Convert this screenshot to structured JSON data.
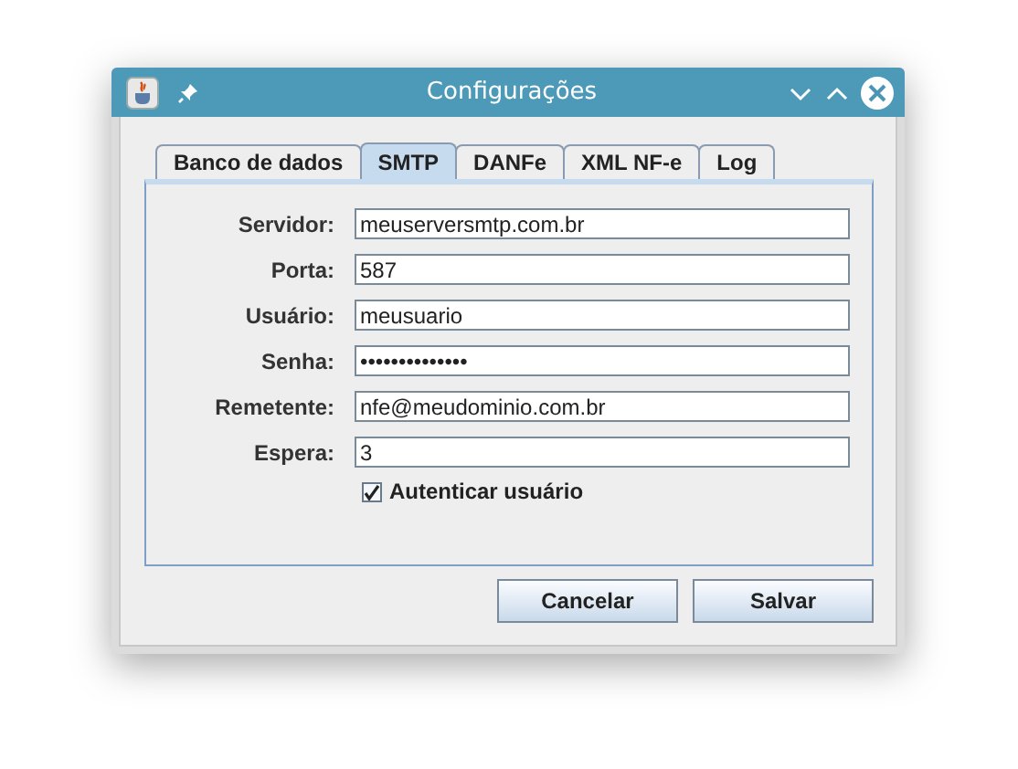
{
  "window": {
    "title": "Configurações"
  },
  "tabs": [
    {
      "label": "Banco de dados",
      "selected": false
    },
    {
      "label": "SMTP",
      "selected": true
    },
    {
      "label": "DANFe",
      "selected": false
    },
    {
      "label": "XML NF-e",
      "selected": false
    },
    {
      "label": "Log",
      "selected": false
    }
  ],
  "fields": [
    {
      "label": "Servidor:",
      "value": "meuserversmtp.com.br"
    },
    {
      "label": "Porta:",
      "value": "587"
    },
    {
      "label": "Usuário:",
      "value": "meusuario"
    },
    {
      "label": "Senha:",
      "value": "••••••••••••••"
    },
    {
      "label": "Remetente:",
      "value": "nfe@meudominio.com.br"
    },
    {
      "label": "Espera:",
      "value": "3"
    }
  ],
  "checkbox": {
    "label": "Autenticar usuário",
    "checked": true
  },
  "buttons": [
    "Cancelar",
    "Salvar"
  ]
}
